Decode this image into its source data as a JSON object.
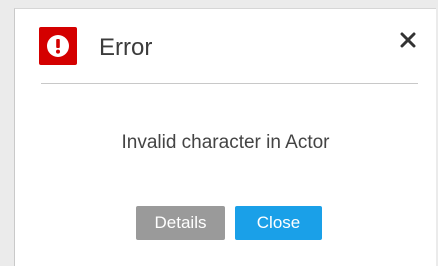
{
  "dialog": {
    "title": "Error",
    "message": "Invalid character in Actor",
    "icons": {
      "status": "error-alert-icon",
      "close": "close-icon"
    },
    "buttons": {
      "details": "Details",
      "close": "Close"
    },
    "colors": {
      "error_icon": "#d40000",
      "details_button": "#9a9a9a",
      "close_button": "#1aa0e8"
    }
  }
}
